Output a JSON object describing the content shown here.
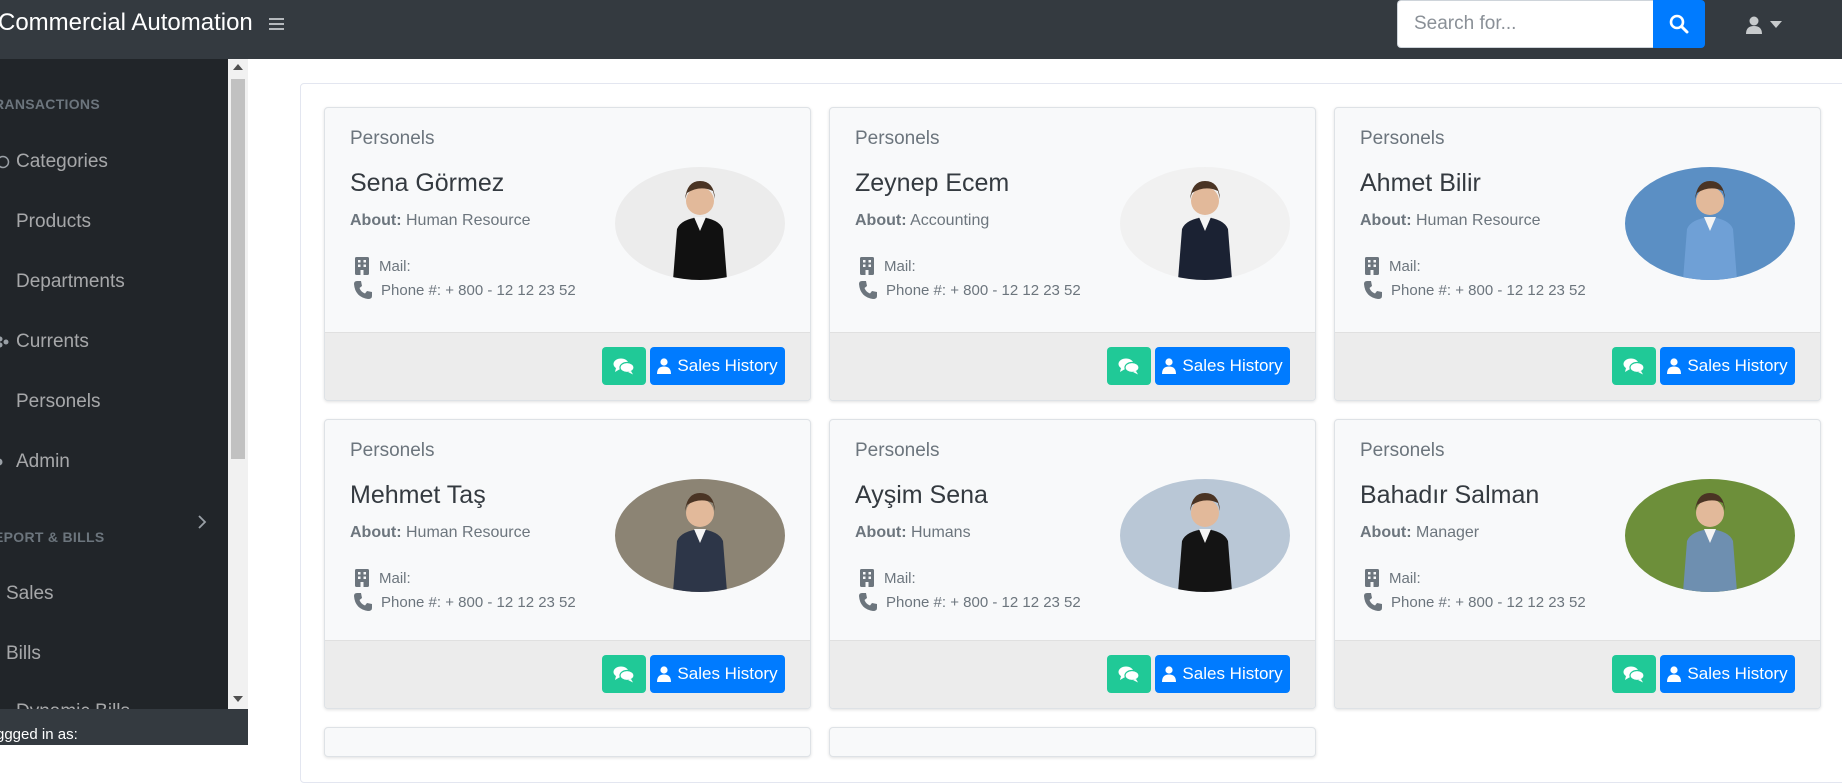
{
  "header": {
    "brand": "Commercial Automation",
    "search_placeholder": "Search for..."
  },
  "sidebar": {
    "headings": [
      "RANSACTIONS",
      "EPORT & BILLS"
    ],
    "items": [
      {
        "label": "Categories",
        "icon": "categories-icon"
      },
      {
        "label": "Products",
        "icon": "products-icon"
      },
      {
        "label": "Departments",
        "icon": "departments-icon"
      },
      {
        "label": "Currents",
        "icon": "users-icon"
      },
      {
        "label": "Personels",
        "icon": "personels-icon"
      },
      {
        "label": "Admin",
        "icon": "admin-icon"
      },
      {
        "label": "Sales",
        "icon": "sales-icon"
      },
      {
        "label": "Bills",
        "icon": "bills-icon"
      },
      {
        "label": "Dynamic Bills",
        "icon": "dynamic-bills-icon"
      }
    ],
    "footer_text": "ggged in as:"
  },
  "cards": [
    {
      "section": "Personels",
      "name": "Sena Görmez",
      "about_label": "About:",
      "about": "Human Resource",
      "mail_label": "Mail:",
      "phone": "Phone #: + 800 - 12 12 23 52",
      "sales_label": "Sales History",
      "photo_bg": "#ececec",
      "suit": "#111111"
    },
    {
      "section": "Personels",
      "name": "Zeynep Ecem",
      "about_label": "About:",
      "about": "Accounting",
      "mail_label": "Mail:",
      "phone": "Phone #: + 800 - 12 12 23 52",
      "sales_label": "Sales History",
      "photo_bg": "#f1f1f1",
      "suit": "#1b2233"
    },
    {
      "section": "Personels",
      "name": "Ahmet Bilir",
      "about_label": "About:",
      "about": "Human Resource",
      "mail_label": "Mail:",
      "phone": "Phone #: + 800 - 12 12 23 52",
      "sales_label": "Sales History",
      "photo_bg": "#5b8fc4",
      "suit": "#6fa0d6"
    },
    {
      "section": "Personels",
      "name": "Mehmet Taş",
      "about_label": "About:",
      "about": "Human Resource",
      "mail_label": "Mail:",
      "phone": "Phone #: + 800 - 12 12 23 52",
      "sales_label": "Sales History",
      "photo_bg": "#8c8474",
      "suit": "#2d3648"
    },
    {
      "section": "Personels",
      "name": "Ayşim Sena",
      "about_label": "About:",
      "about": "Humans",
      "mail_label": "Mail:",
      "phone": "Phone #: + 800 - 12 12 23 52",
      "sales_label": "Sales History",
      "photo_bg": "#b9c7d6",
      "suit": "#141414"
    },
    {
      "section": "Personels",
      "name": "Bahadır Salman",
      "about_label": "About:",
      "about": "Manager",
      "mail_label": "Mail:",
      "phone": "Phone #: + 800 - 12 12 23 52",
      "sales_label": "Sales History",
      "photo_bg": "#6d8f3a",
      "suit": "#6e8fb0"
    }
  ],
  "colors": {
    "topbar": "#343a40",
    "sidebar": "#212529",
    "primary": "#007bff",
    "chat": "#20c997"
  }
}
